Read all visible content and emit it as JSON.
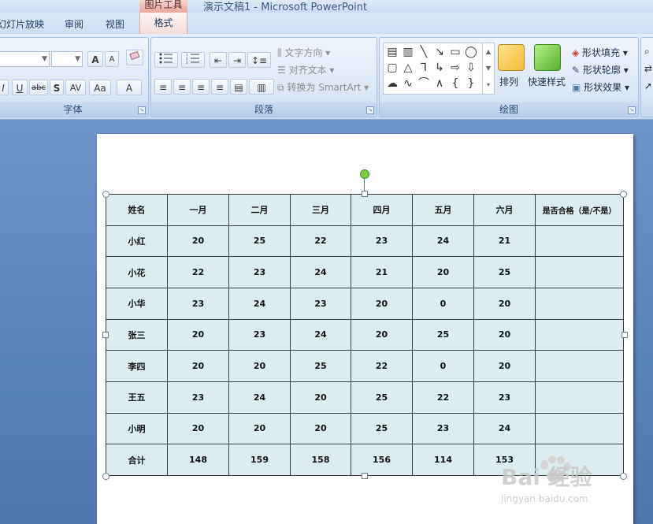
{
  "window": {
    "tool_tab_header": "图片工具",
    "title": "演示文稿1 - Microsoft PowerPoint"
  },
  "tabs": {
    "slideshow": "幻灯片放映",
    "review": "审阅",
    "view": "视图",
    "format": "格式"
  },
  "ribbon": {
    "font_group": {
      "label": "字体",
      "grow_font": "A",
      "shrink_font": "A",
      "underline": "U",
      "strike": "abc",
      "shadow": "S",
      "spacing": "AV",
      "change_case": "Aa",
      "font_color": "A"
    },
    "paragraph_group": {
      "label": "段落",
      "text_direction": "文字方向",
      "align_text": "对齐文本",
      "convert_smartart": "转换为 SmartArt"
    },
    "drawing_group": {
      "label": "绘图",
      "arrange": "排列",
      "quick_styles": "快速样式",
      "shape_fill": "形状填充",
      "shape_outline": "形状轮廓",
      "shape_effects": "形状效果"
    }
  },
  "table": {
    "headers": [
      "姓名",
      "一月",
      "二月",
      "三月",
      "四月",
      "五月",
      "六月",
      "是否合格（是/不是）"
    ],
    "rows": [
      [
        "小红",
        "20",
        "25",
        "22",
        "23",
        "24",
        "21",
        ""
      ],
      [
        "小花",
        "22",
        "23",
        "24",
        "21",
        "20",
        "25",
        ""
      ],
      [
        "小华",
        "23",
        "24",
        "23",
        "20",
        "0",
        "20",
        ""
      ],
      [
        "张三",
        "20",
        "23",
        "24",
        "20",
        "25",
        "20",
        ""
      ],
      [
        "李四",
        "20",
        "20",
        "25",
        "22",
        "0",
        "20",
        ""
      ],
      [
        "王五",
        "23",
        "24",
        "20",
        "25",
        "22",
        "23",
        ""
      ],
      [
        "小明",
        "20",
        "20",
        "20",
        "25",
        "23",
        "24",
        ""
      ],
      [
        "合计",
        "148",
        "159",
        "158",
        "156",
        "114",
        "153",
        ""
      ]
    ]
  },
  "watermark": {
    "brand": "Bai 经验",
    "url": "jingyan.baidu.com"
  },
  "colors": {
    "table_fill": "#dcedf2",
    "workspace": "#5b84bd",
    "tool_tab": "#e9a79f"
  }
}
